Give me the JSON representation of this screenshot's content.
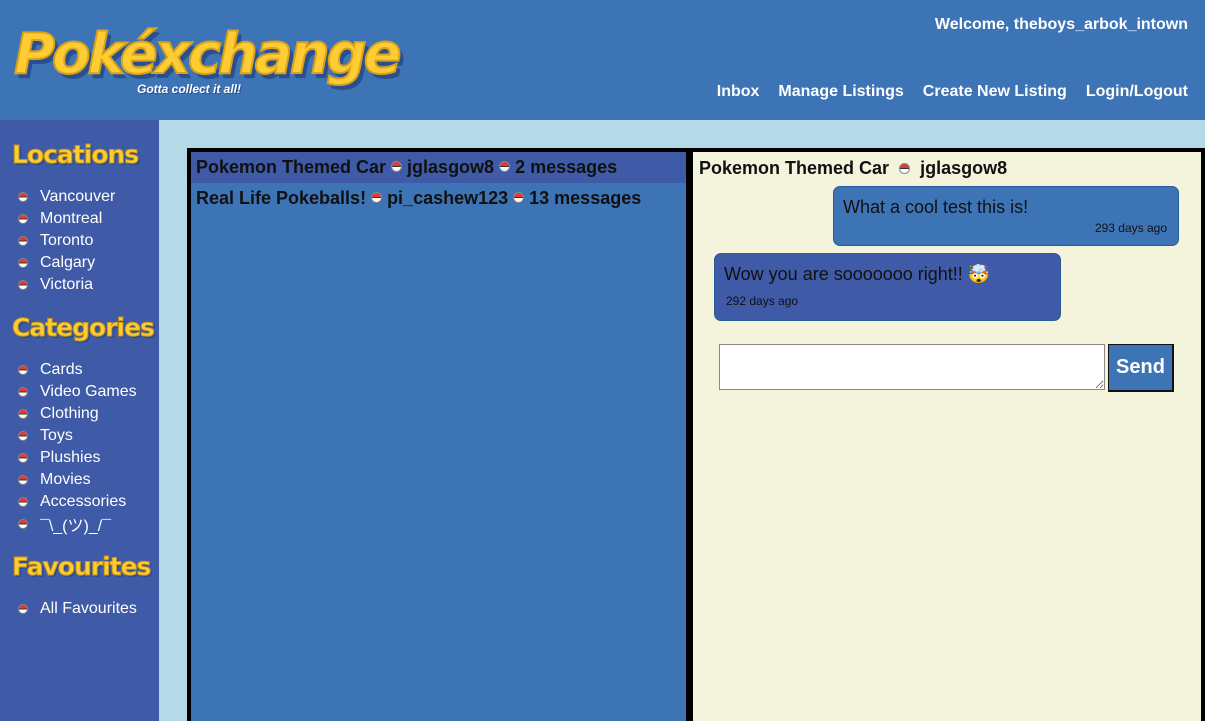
{
  "header": {
    "logo_title": "Pokéxchange",
    "logo_tagline": "Gotta collect it all!",
    "welcome": "Welcome, theboys_arbok_intown",
    "nav": [
      "Inbox",
      "Manage Listings",
      "Create New Listing",
      "Login/Logout"
    ]
  },
  "sidebar": {
    "locations_heading": "Locations",
    "locations": [
      "Vancouver",
      "Montreal",
      "Toronto",
      "Calgary",
      "Victoria"
    ],
    "categories_heading": "Categories",
    "categories": [
      "Cards",
      "Video Games",
      "Clothing",
      "Toys",
      "Plushies",
      "Movies",
      "Accessories",
      "¯\\_(ツ)_/¯"
    ],
    "favourites_heading": "Favourites",
    "favourites": [
      "All Favourites"
    ]
  },
  "conversations": [
    {
      "title": "Pokemon Themed Car",
      "user": "jglasgow8",
      "count": "2 messages",
      "active": true
    },
    {
      "title": "Real Life Pokeballs!",
      "user": "pi_cashew123",
      "count": "13 messages",
      "active": false
    }
  ],
  "chat": {
    "title": "Pokemon Themed Car",
    "user": "jglasgow8",
    "messages": [
      {
        "text": "What a cool test this is!",
        "time": "293 days ago"
      },
      {
        "text": "Wow you are sooooooo right!! 🤯",
        "time": "292 days ago"
      }
    ],
    "input_value": "",
    "send_label": "Send"
  },
  "colors": {
    "header_blue": "#3d74b6",
    "sidebar_blue": "#3f5aa6",
    "accent_yellow": "#ffcc33",
    "chat_bg": "#f4f3dc",
    "page_bg": "#b5d9e6"
  },
  "icons": {
    "list_bullet": "pokeball-icon"
  }
}
